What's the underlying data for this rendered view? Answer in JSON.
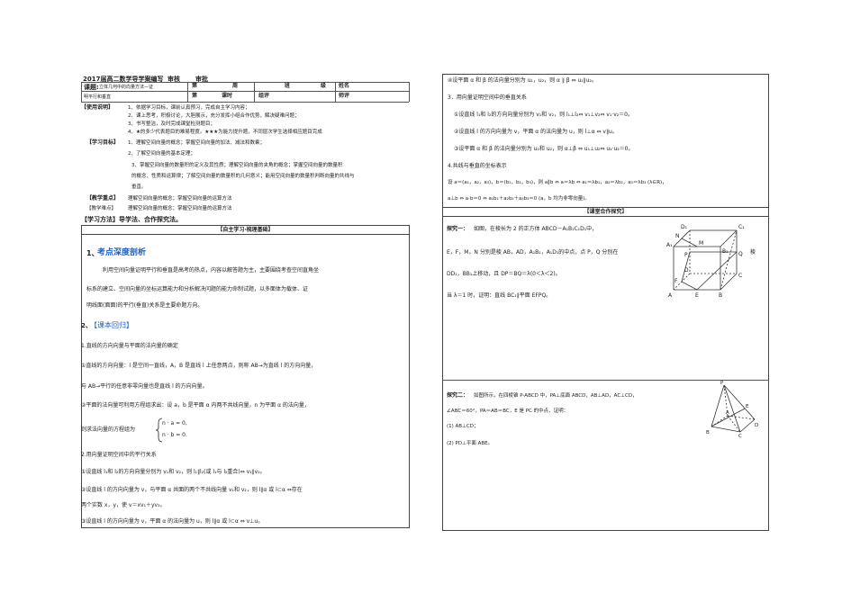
{
  "left": {
    "doc_title": "2017届高二数学导学案编写",
    "reviewers": [
      "审核",
      "审批"
    ],
    "header_table": {
      "topic_label": "课题:",
      "topic_text_1": "立体几何中的向量方法—证",
      "topic_text_2": "明平行和垂直",
      "row1": [
        "第",
        "周",
        "班",
        "级",
        "姓名"
      ],
      "row2": [
        "第",
        "课时",
        "组评",
        "师评"
      ]
    },
    "usage_label": "【使用说明】",
    "usage_items": [
      "1、依据学习目标，课前认真预习，完成自主学习内容；",
      "2、课上思考，积极讨论，大胆展示，充分发挥小组合作优势，解决疑难问题；",
      "3、书写整洁，及时完成课堂检测题目；",
      "4、★的多少代表题目的难易程度。★★★为能力提升题，不同层次学生选择相应题目完成"
    ],
    "goals_label": "【学习目标】",
    "goals": [
      "1、理解空间向量的概念；掌握空间向量的加法、减法和数乘；",
      "2、了解空间向量的基本定理；",
      "3、掌握空间向量的数量积的定义及其性质；理解空间向量的夹角的概念；掌握空间向量的数量积",
      "的概念、性质和运算律；了解空间向量的数量积的几何意义；能用空间向量的数量积判断向量的共线与",
      "垂直。"
    ],
    "key_label": "【教学重点】",
    "key_text": "理解空间向量的概念；掌握空间向量的运算方法",
    "difficulty_label": "【教学难点】",
    "difficulty_text": "理解空间向量的概念；掌握空间向量的运算方法",
    "method": "【学习方法】导学法、合作探究法。",
    "self_study_bar": "【自主学习·梳理基础】",
    "sec1_num": "1、",
    "sec1_title": "考点深度剖析",
    "sec1_body": [
      "利用空间向量证明平行和垂直是高考的热点，内容以解答题为主，主要围绕考查空间直角坐",
      "标系的建立、空间向量的坐标运算能力和分析解决问题的能力命制试题，以多面体为载体、证",
      "明线面(面面)的平行(垂直)关系是主要命题方向。"
    ],
    "sec2_num": "2、",
    "sec2_title": "【课本回归】",
    "s1_title": "1.直线的方向向量与平面的法向量的确定",
    "s1_p1a": "①直线的方向向量：l 是空间一直线，A，B 是直线 l 上任意两点，则称 AB→为直线 l 的方向向量，",
    "s1_p1b": "与 AB→平行的任意非零向量也是直线 l 的方向向量。",
    "s1_p2": "②平面的法向量可利用方程组求出：设 a，b 是平面 α 内两不共线向量，n 为平面 α 的法向量，",
    "s1_p3": "则求法向量的方程组为",
    "s1_sys": [
      "n · a = 0,",
      "n · b = 0."
    ],
    "s2_title": "2.用向量证明空间中的平行关系",
    "s2_items": [
      "①设直线 l₁和 l₂的方向向量分别为 v₁和 v₂，则 l₁∥l₂(或 l₁与 l₂重合)⇔ v₁∥v₂。",
      "②设直线 l 的方向向量为 v，与平面 α 共面的两个不共线向量 v₁和 v₂，则 l∥α 或 l⊂α ⇔存在",
      "两个实数 x，y，使 v＝xv₁＋yv₂。",
      "③设直线 l 的方向向量为 v，平面 α 的法向量为 u，则 l∥α 或 l⊂α ⇔ v⊥u。"
    ]
  },
  "right": {
    "p4": "④设平面 α 和 β 的法向量分别为 u₁，u₂，则 α ∥ β ⇔ u₁∥u₂。",
    "s3_title": "3．用向量证明空间中的垂直关系",
    "s3_items": [
      "①设直线 l₁和 l₂的方向向量分别为 v₁和 v₂，则 l₁⊥l₂⇔ v₁⊥v₂⇔ v₁·v₂＝0。",
      "②设直线 l 的方向向量为 v，平面 α 的法向量为 u，则 l⊥α ⇔ v∥u。",
      "③设平面 α 和 β 的法向量分别为 u₁和 u₂，则 α⊥β ⇔ u₁⊥u₂⇔ u₁·u₂＝0。"
    ],
    "s4_title": "4.共线与垂直的坐标表示",
    "s4_l1": "设 a＝(a₁，a₂，a₃)，b＝(b₁，b₂，b₃)，则 a∥b ⇔ a＝λb ⇔ a₁＝λb₁，a₂＝λb₂，a₃＝λb₃ (λ∈R)，",
    "s4_l2": "a⊥b ⇔ a·b＝0 ⇔ a₁b₁＋a₂b₂＋a₃b₃＝0 (a，b 均为非零向量)。",
    "coop_bar": "【课堂合作探究】",
    "ex1_label": "探究一：",
    "ex1_l1": "如图，在棱长为 2 的正方体 ABCD－A₁B₁C₁D₁中，",
    "ex1_l2": "E，F，M，N 分别是棱 AB，AD，A₁B₁，A₁D₁的中点，点 P，Q 分别在",
    "ex1_l2b": "棱",
    "ex1_l3": "DD₁，BB₁上移动，且 DP＝BQ＝λ(0＜λ＜2)。",
    "ex1_l4": "当 λ＝1 时，证明：直线 BC₁∥平面 EFPQ。",
    "ex2_label": "探究二：",
    "ex2_l1": "如图所示，在四棱锥 P-ABCD 中，PA⊥底面 ABCD，AB⊥AD，AC⊥CD，",
    "ex2_l2": "∠ABC＝60°，PA＝AB＝BC，E 是 PC 的中点．证明：",
    "ex2_q1": "(1) AB⊥CD；",
    "ex2_q2": "(2) PD⊥平面 ABE。",
    "cube_labels": [
      "D₁",
      "C₁",
      "A₁",
      "B₁",
      "N",
      "M",
      "D",
      "C",
      "A",
      "B",
      "E",
      "F",
      "P",
      "Q"
    ],
    "pyr_labels": [
      "P",
      "E",
      "A",
      "B",
      "C",
      "D"
    ]
  }
}
